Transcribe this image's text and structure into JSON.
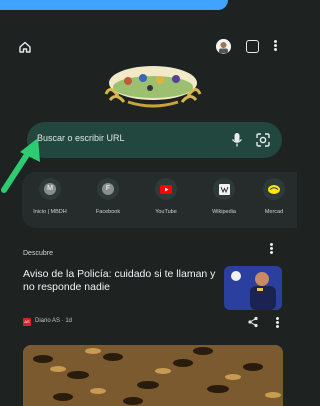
{
  "search": {
    "placeholder": "Buscar o escribir URL"
  },
  "shortcuts": [
    {
      "label": "Inicio | MBDH",
      "initial": "M",
      "icon": "m-icon"
    },
    {
      "label": "Facebook",
      "initial": "F",
      "icon": "facebook-icon"
    },
    {
      "label": "YouTube",
      "initial": "",
      "icon": "youtube-icon"
    },
    {
      "label": "Wikipedia",
      "initial": "",
      "icon": "wikipedia-icon"
    },
    {
      "label": "Mercad",
      "initial": "",
      "icon": "mercado-icon"
    }
  ],
  "feed": {
    "section_title": "Descubre",
    "articles": [
      {
        "title": "Aviso de la Policía: cuidado si te llaman y no responde nadie",
        "source": "Diario AS · 1d",
        "source_logo": "AS"
      }
    ]
  },
  "toolbar": {
    "tab_count": ""
  },
  "colors": {
    "background": "#1e2322",
    "search_bar": "#22473f",
    "accent_blue": "#3fa3ff",
    "arrow_green": "#2ecc71"
  }
}
